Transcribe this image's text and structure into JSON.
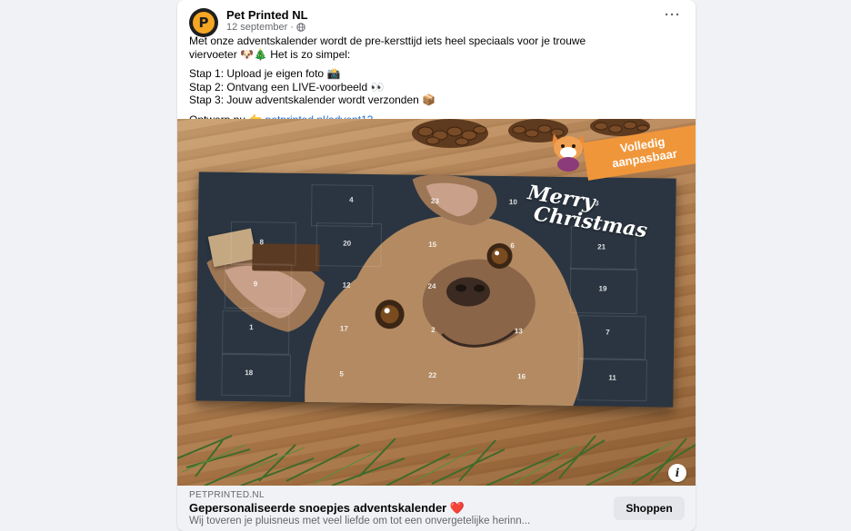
{
  "post": {
    "page_name": "Pet Printed NL",
    "date": "12 september",
    "separator": "·",
    "line1": "Met onze adventskalender wordt de pre-kersttijd iets heel speciaals voor je trouwe",
    "line2": "viervoeter 🐶🎄 Het is zo simpel:",
    "step1": "Stap 1: Upload je eigen foto 📸",
    "step2": "Stap 2: Ontvang een LIVE-voorbeeld 👀",
    "step3": "Stap 3: Jouw adventskalender wordt verzonden 📦",
    "cta_prefix": "Ontwerp nu 👉",
    "cta_link": "petprinted.nl/advent13"
  },
  "image": {
    "banner_line1": "Volledig",
    "banner_line2": "aanpasbaar",
    "merry_line1": "Merry",
    "merry_line2": "Christmas",
    "door_numbers": [
      "4",
      "23",
      "10",
      "3",
      "8",
      "20",
      "15",
      "6",
      "21",
      "9",
      "12",
      "24",
      "19",
      "1",
      "17",
      "2",
      "13",
      "7",
      "18",
      "5",
      "22",
      "16",
      "11"
    ]
  },
  "link_preview": {
    "domain": "PETPRINTED.NL",
    "title": "Gepersonaliseerde snoepjes adventskalender ❤️",
    "description": "Wij toveren je pluisneus met veel liefde om tot een onvergetelijke herinn...",
    "button_label": "Shoppen"
  },
  "icons": {
    "more": "more-options-icon",
    "globe": "globe-icon",
    "info": "info-icon"
  },
  "colors": {
    "link": "#216fdb",
    "banner": "#f0963a",
    "calendar_bg": "#2a3541"
  }
}
